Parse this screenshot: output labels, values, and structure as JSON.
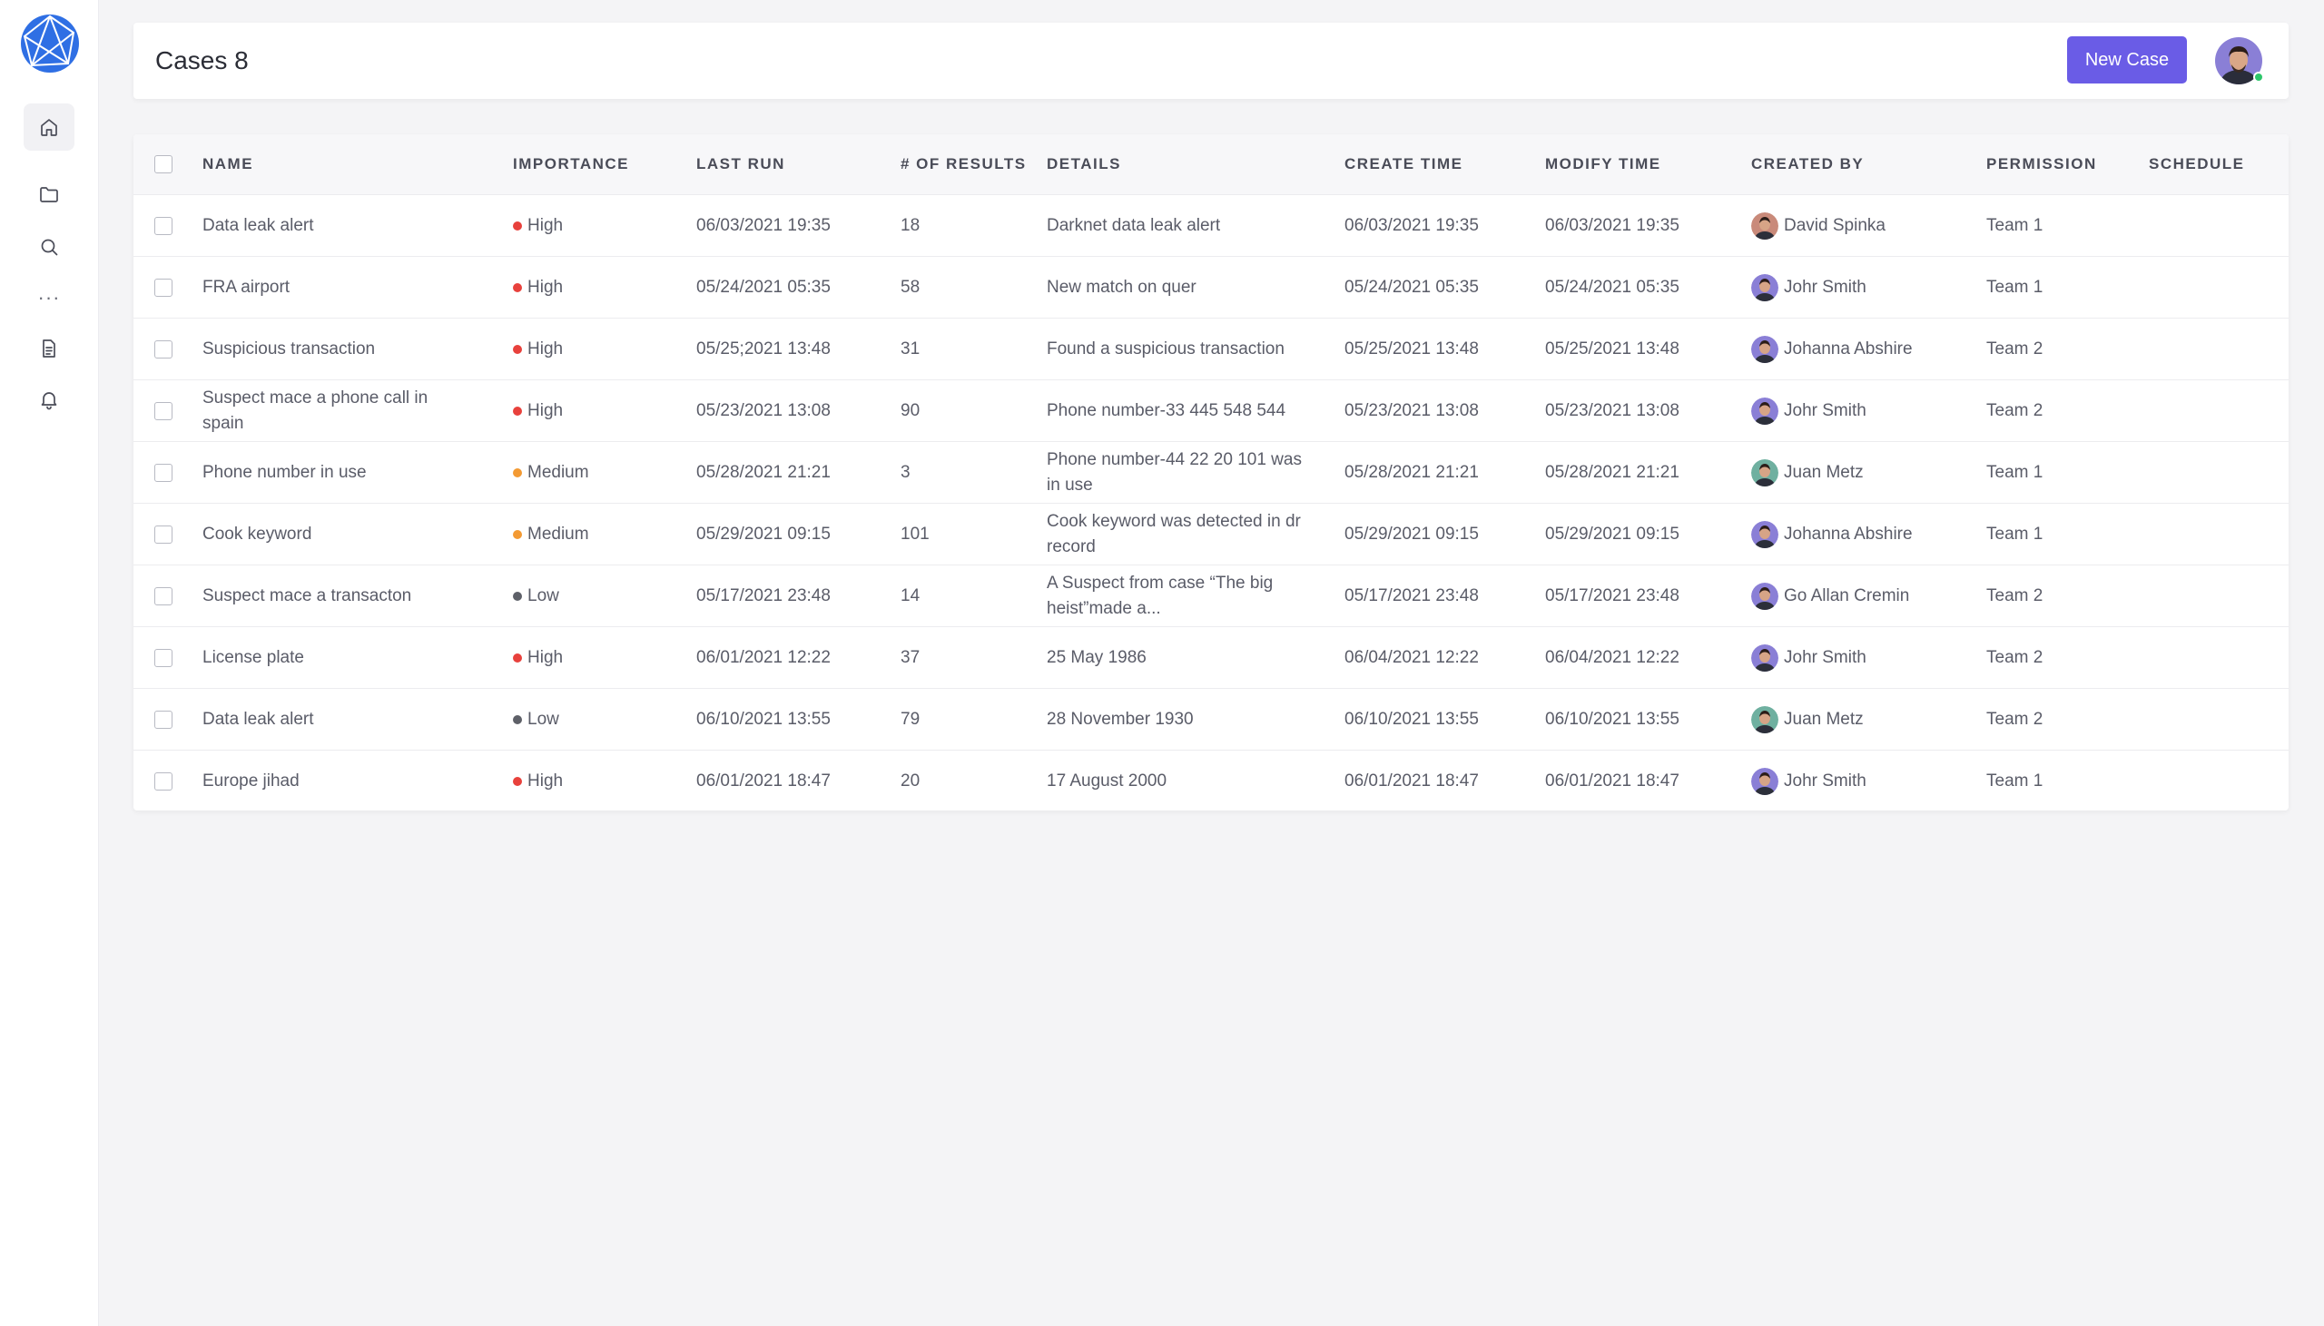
{
  "header": {
    "title": "Cases 8",
    "new_case_label": "New Case"
  },
  "colors": {
    "accent": "#6a5ce6",
    "high": "#e8413c",
    "medium": "#f39a33",
    "low": "#5e6068",
    "online": "#2dc66b"
  },
  "sidebar": {
    "items": [
      {
        "icon": "home-icon"
      },
      {
        "icon": "folder-icon"
      },
      {
        "icon": "search-icon"
      },
      {
        "icon": "more-icon"
      },
      {
        "icon": "document-icon"
      },
      {
        "icon": "bell-icon"
      }
    ]
  },
  "table": {
    "columns": [
      "NAME",
      "IMPORTANCE",
      "LAST RUN",
      "# OF RESULTS",
      "DETAILS",
      "CREATE TIME",
      "MODIFY TIME",
      "CREATED BY",
      "PERMISSION",
      "SCHEDULE"
    ],
    "rows": [
      {
        "name": "Data leak alert",
        "importance": "High",
        "last_run": "06/03/2021 19:35",
        "results": "18",
        "details": "Darknet data leak alert",
        "create_time": "06/03/2021 19:35",
        "modify_time": "06/03/2021 19:35",
        "created_by": "David Spinka",
        "permission": "Team 1",
        "schedule": ""
      },
      {
        "name": "FRA airport",
        "importance": "High",
        "last_run": "05/24/2021 05:35",
        "results": "58",
        "details": "New match on quer",
        "create_time": "05/24/2021 05:35",
        "modify_time": "05/24/2021 05:35",
        "created_by": "Johr Smith",
        "permission": "Team 1",
        "schedule": ""
      },
      {
        "name": "Suspicious transaction",
        "importance": "High",
        "last_run": "05/25;2021 13:48",
        "results": "31",
        "details": "Found a suspicious transaction",
        "create_time": "05/25/2021 13:48",
        "modify_time": "05/25/2021 13:48",
        "created_by": "Johanna Abshire",
        "permission": "Team 2",
        "schedule": ""
      },
      {
        "name": "Suspect mace a phone call in spain",
        "importance": "High",
        "last_run": "05/23/2021 13:08",
        "results": "90",
        "details": "Phone number-33 445 548 544",
        "create_time": "05/23/2021 13:08",
        "modify_time": "05/23/2021 13:08",
        "created_by": "Johr Smith",
        "permission": "Team 2",
        "schedule": ""
      },
      {
        "name": "Phone number in use",
        "importance": "Medium",
        "last_run": "05/28/2021 21:21",
        "results": "3",
        "details": "Phone number-44 22 20 101 was in use",
        "create_time": "05/28/2021 21:21",
        "modify_time": "05/28/2021 21:21",
        "created_by": "Juan Metz",
        "permission": "Team 1",
        "schedule": ""
      },
      {
        "name": "Cook keyword",
        "importance": "Medium",
        "last_run": "05/29/2021 09:15",
        "results": "101",
        "details": "Cook keyword was detected in dr record",
        "create_time": "05/29/2021 09:15",
        "modify_time": "05/29/2021 09:15",
        "created_by": "Johanna Abshire",
        "permission": "Team 1",
        "schedule": ""
      },
      {
        "name": "Suspect mace a transacton",
        "importance": "Low",
        "last_run": "05/17/2021 23:48",
        "results": "14",
        "details": "A Suspect from case “The big heist”made a...",
        "create_time": "05/17/2021 23:48",
        "modify_time": "05/17/2021 23:48",
        "created_by": "Go Allan Cremin",
        "permission": "Team 2",
        "schedule": ""
      },
      {
        "name": "License plate",
        "importance": "High",
        "last_run": "06/01/2021 12:22",
        "results": "37",
        "details": "25 May 1986",
        "create_time": "06/04/2021 12:22",
        "modify_time": "06/04/2021 12:22",
        "created_by": "Johr Smith",
        "permission": "Team 2",
        "schedule": ""
      },
      {
        "name": "Data leak alert",
        "importance": "Low",
        "last_run": "06/10/2021 13:55",
        "results": "79",
        "details": "28 November 1930",
        "create_time": "06/10/2021 13:55",
        "modify_time": "06/10/2021 13:55",
        "created_by": "Juan Metz",
        "permission": "Team 2",
        "schedule": ""
      },
      {
        "name": "Europe jihad",
        "importance": "High",
        "last_run": "06/01/2021 18:47",
        "results": "20",
        "details": "17 August 2000",
        "create_time": "06/01/2021 18:47",
        "modify_time": "06/01/2021 18:47",
        "created_by": "Johr Smith",
        "permission": "Team 1",
        "schedule": ""
      }
    ]
  }
}
